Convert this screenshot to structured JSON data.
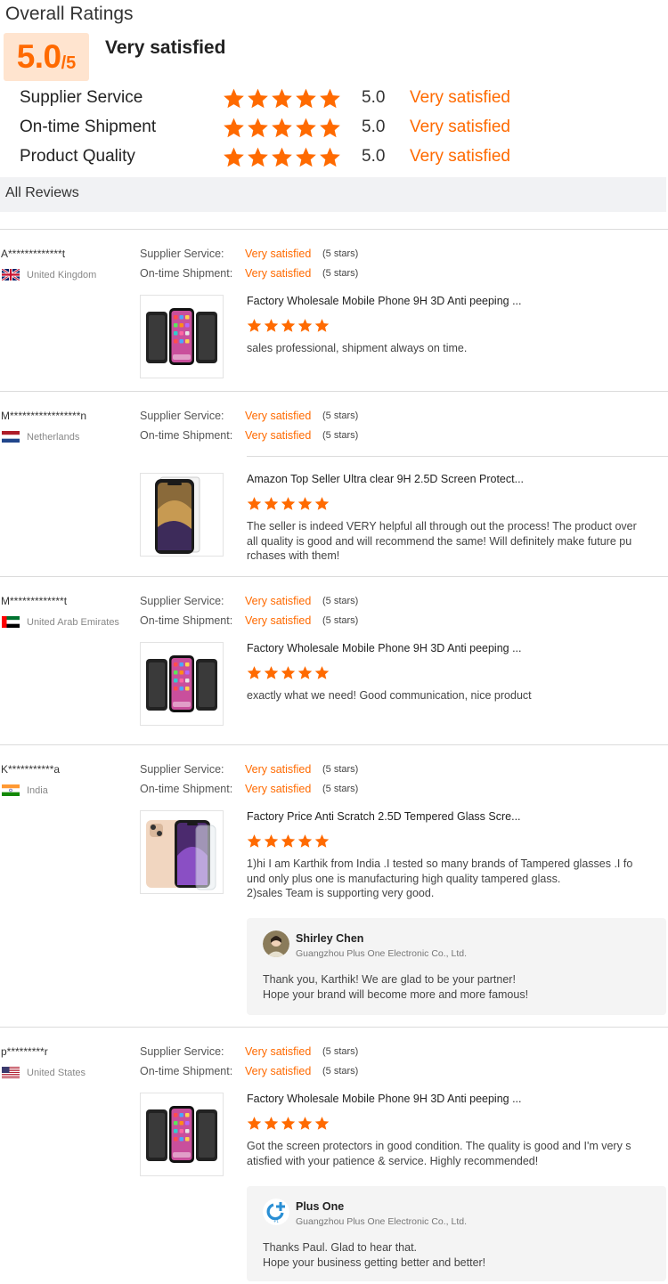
{
  "overall": {
    "title": "Overall Ratings",
    "score": "5.0",
    "score_out_of": "/5",
    "label": "Very satisfied",
    "rows": [
      {
        "label": "Supplier Service",
        "value": "5.0",
        "text": "Very satisfied",
        "stars": 5
      },
      {
        "label": "On-time Shipment",
        "value": "5.0",
        "text": "Very satisfied",
        "stars": 5
      },
      {
        "label": "Product Quality",
        "value": "5.0",
        "text": "Very satisfied",
        "stars": 5
      }
    ]
  },
  "all_reviews_label": "All Reviews",
  "sub_labels": {
    "supplier_service": "Supplier Service:",
    "ontime_shipment": "On-time Shipment:"
  },
  "reviews": [
    {
      "name": "A*************t",
      "country": "United Kingdom",
      "flag": "uk-flag",
      "supplier_service": "Very satisfied",
      "supplier_service_stars": "(5 stars)",
      "shipment": "Very satisfied",
      "shipment_stars": "(5 stars)",
      "product_title": "Factory Wholesale Mobile Phone 9H 3D Anti peeping ...",
      "product_icon": "privacy-phones-thumb",
      "rating": 5,
      "text": [
        "sales professional, shipment always on time."
      ]
    },
    {
      "name": "M*****************n",
      "country": "Netherlands",
      "flag": "netherlands-flag",
      "supplier_service": "Very satisfied",
      "supplier_service_stars": "(5 stars)",
      "shipment": "Very satisfied",
      "shipment_stars": "(5 stars)",
      "product_title": "Amazon Top Seller Ultra clear 9H 2.5D Screen Protect...",
      "product_icon": "iphone-xs-thumb",
      "rating": 5,
      "text": [
        "The seller is indeed VERY helpful all through out the process! The product over",
        "all quality is good and will recommend the same! Will definitely make future pu",
        "rchases with them!"
      ]
    },
    {
      "name": "M*************t",
      "country": "United Arab Emirates",
      "flag": "uae-flag",
      "supplier_service": "Very satisfied",
      "supplier_service_stars": "(5 stars)",
      "shipment": "Very satisfied",
      "shipment_stars": "(5 stars)",
      "product_title": "Factory Wholesale Mobile Phone 9H 3D Anti peeping ...",
      "product_icon": "privacy-phones-thumb",
      "rating": 5,
      "text": [
        "exactly what we need! Good communication, nice product"
      ]
    },
    {
      "name": "K***********a",
      "country": "India",
      "flag": "india-flag",
      "supplier_service": "Very satisfied",
      "supplier_service_stars": "(5 stars)",
      "shipment": "Very satisfied",
      "shipment_stars": "(5 stars)",
      "product_title": "Factory Price Anti Scratch 2.5D Tempered Glass Scre...",
      "product_icon": "iphone-11-thumb",
      "rating": 5,
      "text": [
        "1)hi I am Karthik from India .I tested so many  brands of Tampered glasses .I fo",
        "und only plus one  is manufacturing high quality tampered glass.",
        "2)sales Team is supporting very good."
      ],
      "reply": {
        "name": "Shirley Chen",
        "company": "Guangzhou Plus One Electronic Co., Ltd.",
        "text": [
          "Thank you, Karthik! We are glad to be your partner!",
          "Hope your brand will become more and more famous!"
        ]
      }
    },
    {
      "name": "p*********r",
      "country": "United States",
      "flag": "us-flag",
      "supplier_service": "Very satisfied",
      "supplier_service_stars": "(5 stars)",
      "shipment": "Very satisfied",
      "shipment_stars": "(5 stars)",
      "product_title": "Factory Wholesale Mobile Phone 9H 3D Anti peeping ...",
      "product_icon": "privacy-phones-thumb",
      "rating": 5,
      "text": [
        "Got the screen protectors in good condition. The quality is good and I'm very s",
        "atisfied with your patience & service. Highly recommended!"
      ],
      "reply": {
        "name": "Plus One",
        "company": "Guangzhou Plus One Electronic Co., Ltd.",
        "text": [
          "Thanks Paul. Glad to hear that.",
          "Hope your business getting better and better!"
        ]
      }
    }
  ]
}
